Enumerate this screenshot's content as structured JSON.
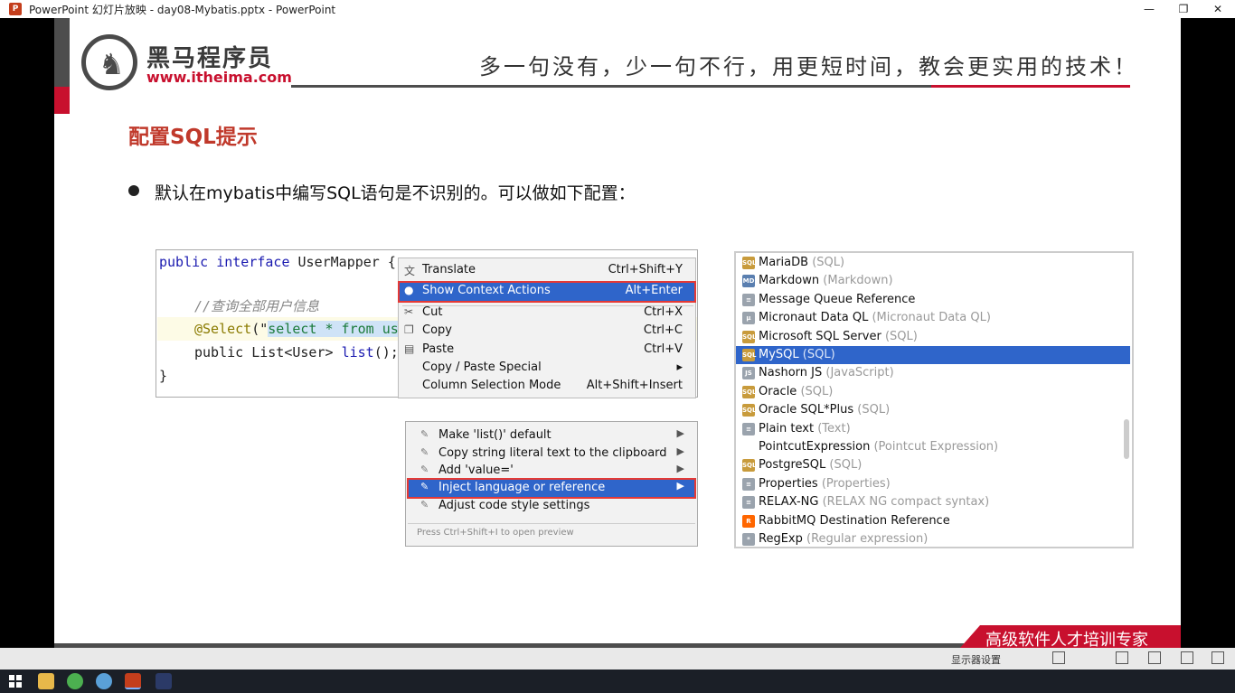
{
  "window": {
    "title": "PowerPoint 幻灯片放映  -  day08-Mybatis.pptx  -  PowerPoint",
    "app_icon": "P",
    "controls": [
      "—",
      "❐",
      "✕"
    ]
  },
  "slide": {
    "logo": {
      "name_cn": "黑马程序员",
      "url": "www.itheima.com"
    },
    "slogan": "多一句没有，少一句不行，用更短时间，教会更实用的技术！",
    "title": "配置SQL提示",
    "bullet": "默认在mybatis中编写SQL语句是不识别的。可以做如下配置：",
    "banner": "高级软件人才培训专家",
    "colors": {
      "accent_red": "#c8102e",
      "title_red": "#c0392b",
      "dark_gray": "#4d4d4d",
      "selection_blue": "#2f65ca"
    }
  },
  "code": {
    "line1_kw": "public interface",
    "line1_rest": " UserMapper {",
    "comment": "//查询全部用户信息",
    "annotation": "@Select",
    "anno_open": "(\"",
    "sql_visible": "select * from us",
    "line4_kw": "public",
    "line4_type": " List<User> ",
    "line4_method": "list",
    "line4_end": "();",
    "close": "}"
  },
  "context_menu": {
    "items": [
      {
        "icon": "translate-icon",
        "glyph": "文",
        "label": "Translate",
        "shortcut": "Ctrl+Shift+Y",
        "selected": false
      },
      {
        "icon": "lightbulb-icon",
        "glyph": "●",
        "label": "Show Context Actions",
        "shortcut": "Alt+Enter",
        "selected": true
      },
      {
        "icon": "scissors-icon",
        "glyph": "✂",
        "label": "Cut",
        "shortcut": "Ctrl+X",
        "selected": false
      },
      {
        "icon": "copy-icon",
        "glyph": "❐",
        "label": "Copy",
        "shortcut": "Ctrl+C",
        "selected": false
      },
      {
        "icon": "paste-icon",
        "glyph": "▤",
        "label": "Paste",
        "shortcut": "Ctrl+V",
        "selected": false
      },
      {
        "icon": "",
        "glyph": "",
        "label": "Copy / Paste Special",
        "shortcut": "▸",
        "selected": false
      },
      {
        "icon": "",
        "glyph": "",
        "label": "Column Selection Mode",
        "shortcut": "Alt+Shift+Insert",
        "selected": false
      }
    ]
  },
  "intention_menu": {
    "items": [
      {
        "label": "Make 'list()' default",
        "arrow": "▶",
        "selected": false
      },
      {
        "label": "Copy string literal text to the clipboard",
        "arrow": "▶",
        "selected": false
      },
      {
        "label": "Add 'value='",
        "arrow": "▶",
        "selected": false
      },
      {
        "label": "Inject language or reference",
        "arrow": "▶",
        "selected": true
      },
      {
        "label": "Adjust code style settings",
        "arrow": "",
        "selected": false
      }
    ],
    "footer": "Press Ctrl+Shift+I to open preview"
  },
  "language_list": {
    "items": [
      {
        "name": "MariaDB",
        "desc": "(SQL)",
        "icon": "sql",
        "icon_text": "SQL",
        "selected": false
      },
      {
        "name": "Markdown",
        "desc": "(Markdown)",
        "icon": "md",
        "icon_text": "MD",
        "selected": false
      },
      {
        "name": "Message Queue Reference",
        "desc": "",
        "icon": "generic",
        "icon_text": "≡",
        "selected": false
      },
      {
        "name": "Micronaut Data QL",
        "desc": "(Micronaut Data QL)",
        "icon": "generic",
        "icon_text": "μ",
        "selected": false
      },
      {
        "name": "Microsoft SQL Server",
        "desc": "(SQL)",
        "icon": "sql",
        "icon_text": "SQL",
        "selected": false
      },
      {
        "name": "MySQL",
        "desc": "(SQL)",
        "icon": "sql",
        "icon_text": "SQL",
        "selected": true
      },
      {
        "name": "Nashorn JS",
        "desc": "(JavaScript)",
        "icon": "generic",
        "icon_text": "JS",
        "selected": false
      },
      {
        "name": "Oracle",
        "desc": "(SQL)",
        "icon": "sql",
        "icon_text": "SQL",
        "selected": false
      },
      {
        "name": "Oracle SQL*Plus",
        "desc": "(SQL)",
        "icon": "sql",
        "icon_text": "SQL",
        "selected": false
      },
      {
        "name": "Plain text",
        "desc": "(Text)",
        "icon": "generic",
        "icon_text": "≡",
        "selected": false
      },
      {
        "name": "PointcutExpression",
        "desc": "(Pointcut Expression)",
        "icon": "none",
        "icon_text": "",
        "selected": false
      },
      {
        "name": "PostgreSQL",
        "desc": "(SQL)",
        "icon": "sql",
        "icon_text": "SQL",
        "selected": false
      },
      {
        "name": "Properties",
        "desc": "(Properties)",
        "icon": "generic",
        "icon_text": "≡",
        "selected": false
      },
      {
        "name": "RELAX-NG",
        "desc": "(RELAX NG compact syntax)",
        "icon": "generic",
        "icon_text": "≡",
        "selected": false
      },
      {
        "name": "RabbitMQ Destination Reference",
        "desc": "",
        "icon": "rabbit",
        "icon_text": "R",
        "selected": false
      },
      {
        "name": "RegExp",
        "desc": "(Regular expression)",
        "icon": "generic",
        "icon_text": "*",
        "selected": false
      }
    ]
  },
  "slideshow_bar": {
    "monitor_label": "显示器设置"
  },
  "taskbar": {
    "apps": [
      "file-explorer",
      "chrome",
      "network",
      "powerpoint",
      "intellij-idea"
    ]
  }
}
